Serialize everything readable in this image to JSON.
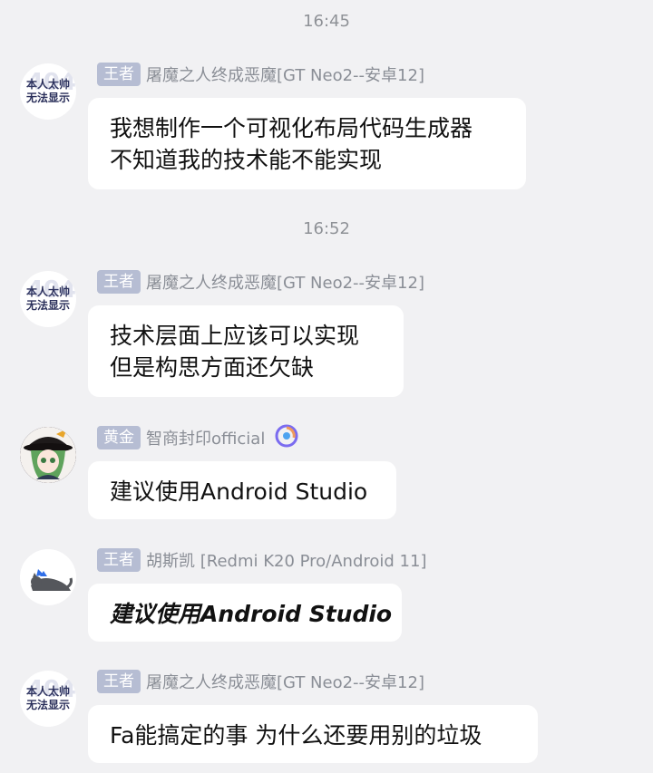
{
  "chat": {
    "time1": "16:45",
    "time2": "16:52",
    "messages": [
      {
        "badge": "王者",
        "nick": "屠魔之人终成恶魔[GT Neo2--安卓12]",
        "avatar_text": [
          "本人太帅",
          "无法显示"
        ],
        "avatar_ghost": "404",
        "lines": [
          "我想制作一个可视化布局代码生成器",
          "不知道我的技术能不能实现"
        ]
      },
      {
        "badge": "王者",
        "nick": "屠魔之人终成恶魔[GT Neo2--安卓12]",
        "avatar_text": [
          "本人太帅",
          "无法显示"
        ],
        "avatar_ghost": "404",
        "lines": [
          "技术层面上应该可以实现",
          "但是构思方面还欠缺"
        ]
      },
      {
        "badge": "黄金",
        "nick": "智商封印official",
        "lines": [
          "建议使用Android Studio"
        ]
      },
      {
        "badge": "王者",
        "nick": "胡斯凯 [Redmi K20 Pro/Android 11]",
        "lines": [
          "建议使用Android Studio"
        ]
      },
      {
        "badge": "王者",
        "nick": "屠魔之人终成恶魔[GT Neo2--安卓12]",
        "avatar_text": [
          "本人太帅",
          "无法显示"
        ],
        "avatar_ghost": "404",
        "lines": [
          "Fa能搞定的事 为什么还要用别的垃圾"
        ]
      }
    ]
  },
  "colors": {
    "background": "#f1f1f3",
    "badge": "#b6bdd3",
    "bubble": "#ffffff"
  }
}
